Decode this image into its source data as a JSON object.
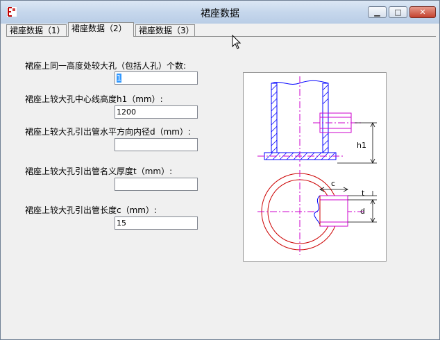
{
  "window": {
    "title": "裙座数据"
  },
  "tabs": [
    {
      "label": "裙座数据（1）"
    },
    {
      "label": "裙座数据（2）",
      "active": true
    },
    {
      "label": "裙座数据（3）"
    }
  ],
  "fields": [
    {
      "label": "裙座上同一高度处较大孔（包括人孔）个数:",
      "value": "1"
    },
    {
      "label": "裙座上较大孔中心线高度h1（mm）:",
      "value": "1200"
    },
    {
      "label": "裙座上较大孔引出管水平方向内径d（mm）:",
      "value": ""
    },
    {
      "label": "裙座上较大孔引出管名义厚度t（mm）:",
      "value": ""
    },
    {
      "label": "裙座上较大孔引出管长度c（mm）:",
      "value": "15"
    }
  ],
  "diagram": {
    "label_h1": "h1",
    "label_c": "c",
    "label_t": "t",
    "label_d": "d"
  },
  "colors": {
    "section_blue": "#0000ff",
    "center_magenta": "#cc00cc",
    "circle_red": "#cc0000",
    "dimension_black": "#000000"
  }
}
